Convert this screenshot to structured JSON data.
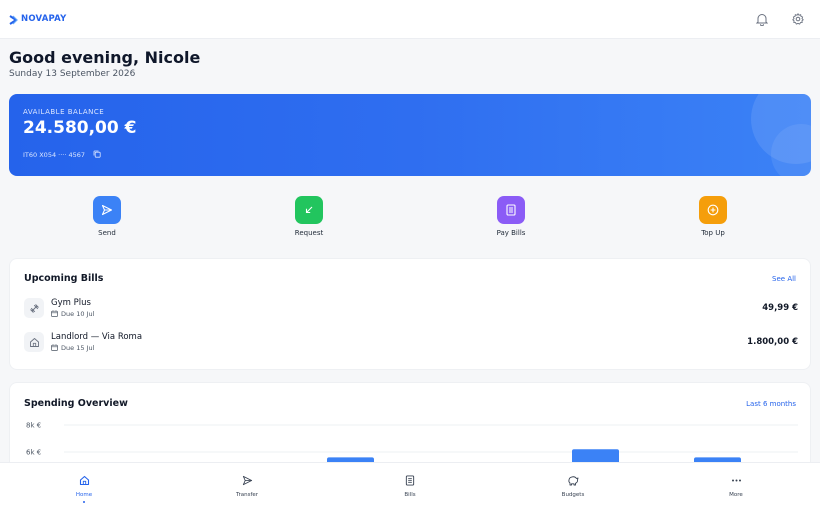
{
  "app": {
    "brand": "NOVAPAY"
  },
  "header": {
    "greeting": "Good evening, Nicole",
    "date": "Sunday 13 September 2026"
  },
  "balance": {
    "label": "AVAILABLE BALANCE",
    "amount": "24.580,00 €",
    "iban": "IT60 X054 ···· 4567"
  },
  "actions": [
    {
      "label": "Send",
      "icon": "send-icon",
      "color": "#3b82f6"
    },
    {
      "label": "Request",
      "icon": "request-arrow-icon",
      "color": "#22c55e"
    },
    {
      "label": "Pay Bills",
      "icon": "receipt-icon",
      "color": "#8b5cf6"
    },
    {
      "label": "Top Up",
      "icon": "plus-circle-icon",
      "color": "#f59e0b"
    }
  ],
  "bills": {
    "title": "Upcoming Bills",
    "see_all": "See All",
    "items": [
      {
        "name": "Gym Plus",
        "due": "Due 10 Jul",
        "amount": "49,99 €",
        "icon": "dumbbell-icon"
      },
      {
        "name": "Landlord — Via Roma",
        "due": "Due 15 Jul",
        "amount": "1.800,00 €",
        "icon": "home-icon"
      }
    ]
  },
  "spending": {
    "title": "Spending Overview",
    "range": "Last 6 months"
  },
  "chart_data": {
    "type": "bar",
    "y_ticks": [
      "8k €",
      "6k €"
    ],
    "visible_bar_levels_k": [
      5.6,
      6.2,
      5.6
    ],
    "ylim": [
      0,
      8
    ]
  },
  "nav": [
    {
      "label": "Home",
      "icon": "home-icon",
      "active": true
    },
    {
      "label": "Transfer",
      "icon": "send-icon",
      "active": false
    },
    {
      "label": "Bills",
      "icon": "receipt-icon",
      "active": false
    },
    {
      "label": "Budgets",
      "icon": "piggy-bank-icon",
      "active": false
    },
    {
      "label": "More",
      "icon": "more-dots-icon",
      "active": false
    }
  ],
  "colors": {
    "accent": "#2563eb",
    "card_gradient_start": "#2563eb",
    "card_gradient_end": "#3b82f6"
  }
}
